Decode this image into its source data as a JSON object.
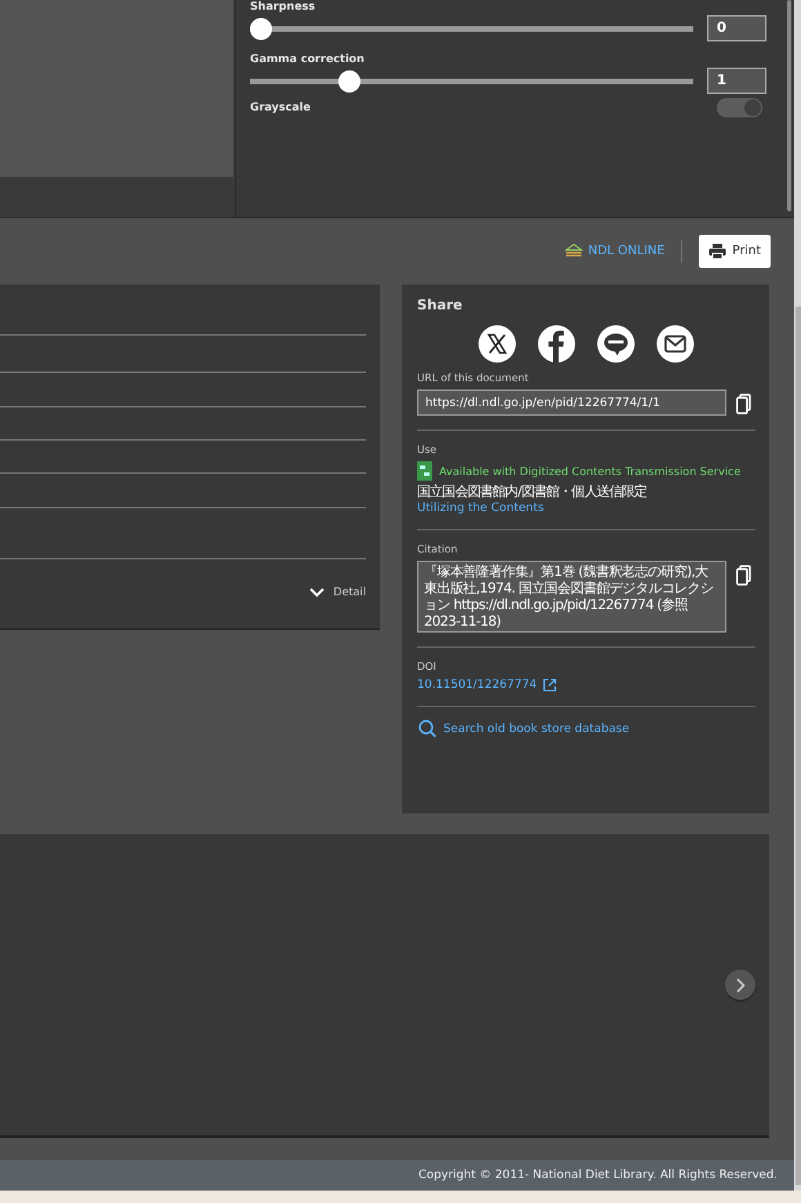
{
  "image_adjustments": {
    "sliders": [
      {
        "label": "Sharpness",
        "level": 0,
        "value": "0"
      },
      {
        "label": "Gamma correction",
        "level": 0.21,
        "value": "1"
      }
    ],
    "toggles": [
      {
        "label": "Grayscale",
        "on": true,
        "disabled": true
      }
    ]
  },
  "toolbar": {
    "link": "NDL ONLINE",
    "print_button": "Print"
  },
  "details_card": {
    "detail_link": "Detail",
    "expanded": false
  },
  "share": {
    "title": "Share",
    "networks": [
      {
        "kind": "x"
      },
      {
        "kind": "facebook"
      },
      {
        "kind": "line"
      },
      {
        "kind": "mail"
      }
    ],
    "url_label": "URL of this document",
    "url_value": "https://dl.ndl.go.jp/en/pid/12267774/1/1",
    "use_label": "Use",
    "availability": "Available with Digitized Contents Transmission Service",
    "access": "国立国会図書館内/図書館・個人送信限定",
    "utilizing_link": "Utilizing the Contents",
    "citation_label": "Citation",
    "citation_text": "『塚本善隆著作集』第1巻 (魏書釈老志の研究),大東出版社,1974. 国立国会図書館デジタルコレクション https://dl.ndl.go.jp/pid/12267774 (参照 2023-11-18)",
    "doi_label": "DOI",
    "doi_link": "10.11501/12267774",
    "search_link": "Search old book store database"
  },
  "footer": "Copyright © 2011- National Diet Library. All Rights Reserved."
}
